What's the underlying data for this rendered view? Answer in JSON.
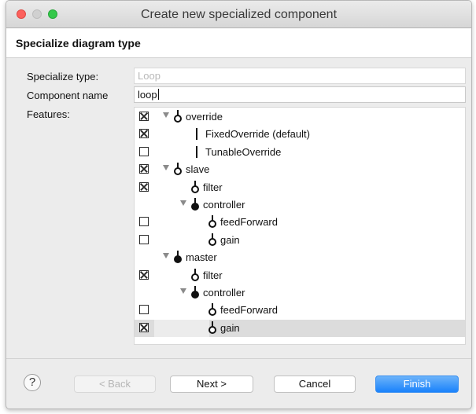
{
  "window": {
    "title": "Create new specialized component",
    "colors": {
      "close": "#fc605c",
      "minimize": "#d0d0d0",
      "maximize": "#34c84a",
      "accent": "#1a82fb"
    }
  },
  "header": {
    "title": "Specialize diagram type"
  },
  "form": {
    "specialize_type_label": "Specialize type:",
    "specialize_type_value": "Loop",
    "component_name_label": "Component name",
    "component_name_value": "loop",
    "features_label": "Features:"
  },
  "features": [
    {
      "label": "override",
      "checked": true,
      "icon": "open-port-icon",
      "expander": "expanded",
      "level": 0
    },
    {
      "label": "FixedOverride (default)",
      "checked": true,
      "icon": "bar-icon",
      "expander": "none",
      "level": 1
    },
    {
      "label": "TunableOverride",
      "checked": false,
      "icon": "bar-icon",
      "expander": "none",
      "level": 1
    },
    {
      "label": "slave",
      "checked": true,
      "icon": "open-port-icon",
      "expander": "expanded",
      "level": 0
    },
    {
      "label": "filter",
      "checked": true,
      "icon": "open-port-icon",
      "expander": "none",
      "level": 1
    },
    {
      "label": "controller",
      "checked": null,
      "icon": "filled-port-icon",
      "expander": "expanded",
      "level": 1
    },
    {
      "label": "feedForward",
      "checked": false,
      "icon": "open-port-icon",
      "expander": "none",
      "level": 2
    },
    {
      "label": "gain",
      "checked": false,
      "icon": "open-port-icon",
      "expander": "none",
      "level": 2
    },
    {
      "label": "master",
      "checked": null,
      "icon": "filled-port-icon",
      "expander": "expanded",
      "level": 0
    },
    {
      "label": "filter",
      "checked": true,
      "icon": "open-port-icon",
      "expander": "none",
      "level": 1
    },
    {
      "label": "controller",
      "checked": null,
      "icon": "filled-port-icon",
      "expander": "expanded",
      "level": 1
    },
    {
      "label": "feedForward",
      "checked": false,
      "icon": "open-port-icon",
      "expander": "none",
      "level": 2
    },
    {
      "label": "gain",
      "checked": true,
      "icon": "open-port-icon",
      "expander": "none",
      "level": 2,
      "selected": true
    }
  ],
  "buttons": {
    "help": "?",
    "back": "< Back",
    "next": "Next >",
    "cancel": "Cancel",
    "finish": "Finish"
  }
}
